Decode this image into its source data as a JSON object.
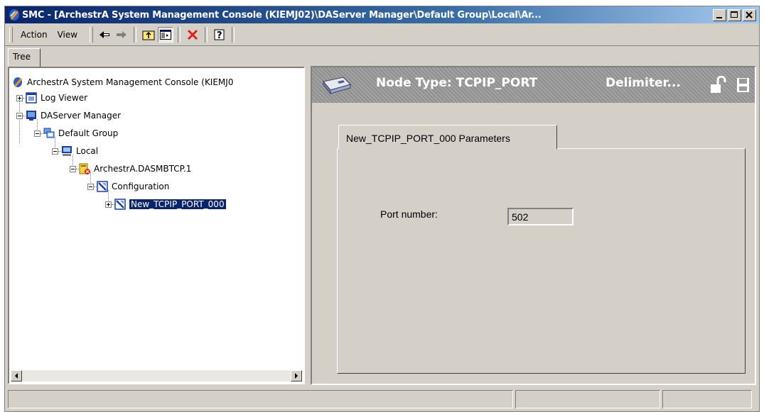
{
  "window": {
    "title": "SMC - [ArchestrA System Management Console (KIEMJ02)\\DAServer Manager\\Default Group\\Local\\Ar..."
  },
  "menu": {
    "action": "Action",
    "view": "View"
  },
  "tree": {
    "tab_label": "Tree",
    "items": [
      {
        "label": "ArchestrA System Management Console (KIEMJ0",
        "icon": "smc-icon"
      },
      {
        "label": "Log Viewer",
        "icon": "log-viewer-icon"
      },
      {
        "label": "DAServer Manager",
        "icon": "daserver-manager-icon"
      },
      {
        "label": "Default Group",
        "icon": "group-icon"
      },
      {
        "label": "Local",
        "icon": "computer-icon"
      },
      {
        "label": "ArchestrA.DASMBTCP.1",
        "icon": "daserver-icon"
      },
      {
        "label": "Configuration",
        "icon": "configuration-icon"
      },
      {
        "label": "New_TCPIP_PORT_000",
        "icon": "port-icon"
      }
    ]
  },
  "details": {
    "node_type": "Node Type: TCPIP_PORT",
    "delimiter": "Delimiter...",
    "tab_label": "New_TCPIP_PORT_000 Parameters",
    "port_label": "Port number:",
    "port_value": "502"
  },
  "colors": {
    "title_start": "#0a246a",
    "title_end": "#a6caf0",
    "selection": "#0a246a",
    "chrome": "#d4d0c8"
  }
}
